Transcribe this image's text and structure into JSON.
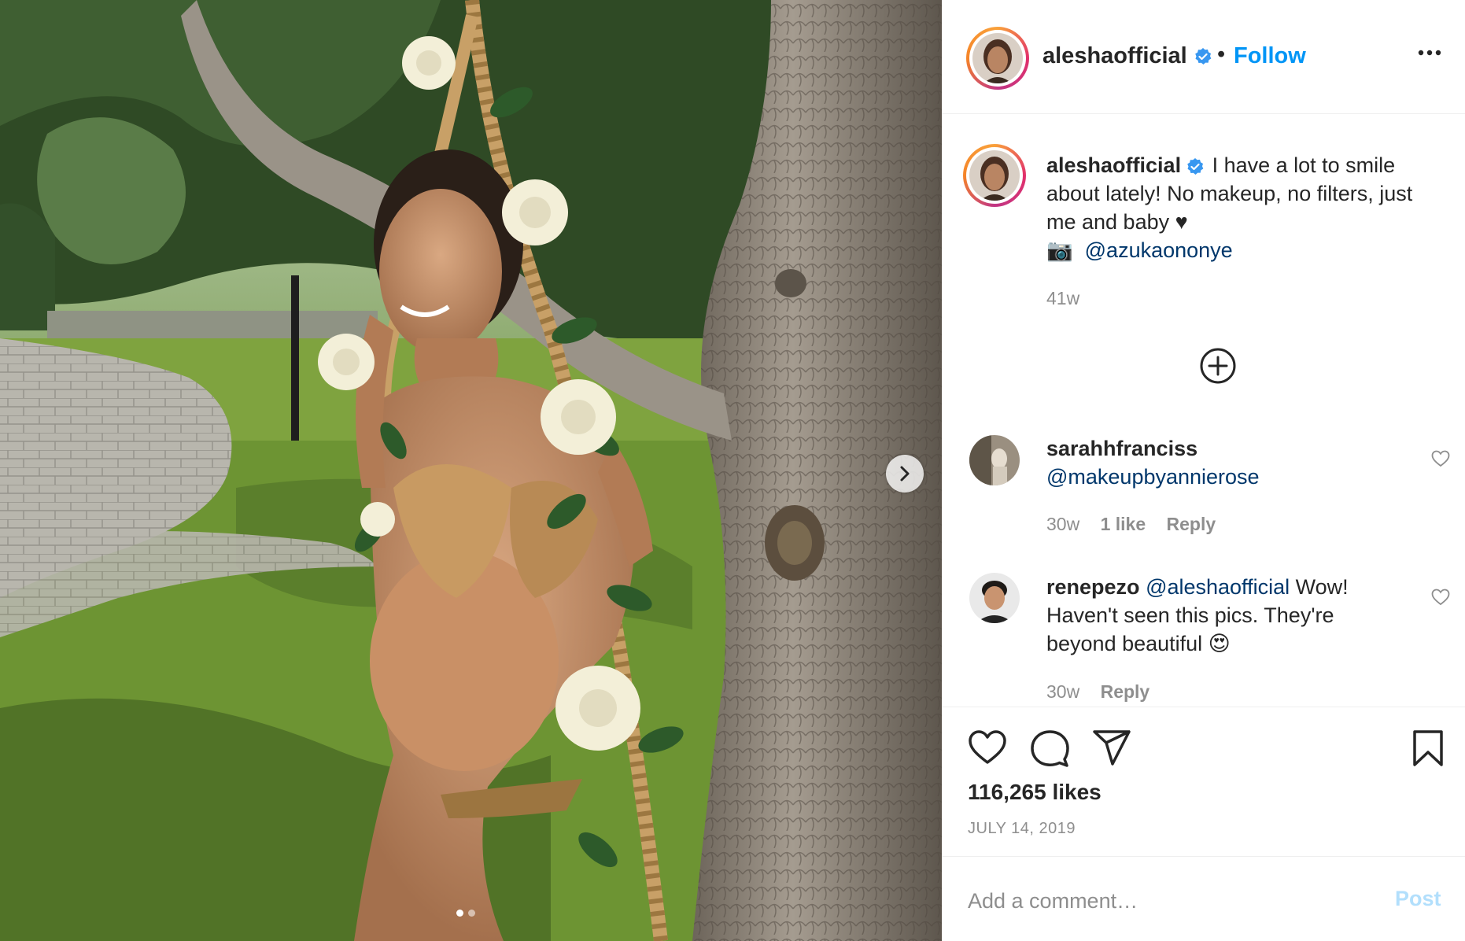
{
  "post": {
    "image_alt": "Photo of a pregnant woman on a rope swing decorated with white roses beside a tree",
    "slide_count": 2,
    "active_slide": 1
  },
  "header": {
    "username": "aleshaofficial",
    "separator": "•",
    "follow_label": "Follow",
    "more_icon": "more-options-icon"
  },
  "caption": {
    "username": "aleshaofficial",
    "text": " I have a lot to smile about lately! No makeup, no filters, just me and baby ♥",
    "camera_emoji": "📷",
    "mention": "@azukaononye",
    "time": "41w"
  },
  "comments": [
    {
      "username": "sarahhfranciss",
      "mention": "@makeupbyannierose",
      "text": "",
      "time": "30w",
      "likes": "1 like",
      "reply": "Reply"
    },
    {
      "username": "renepezo",
      "mention": "@aleshaofficial",
      "text": " Wow! Haven't seen this pics. They're beyond beautiful 😍",
      "time": "30w",
      "likes": "",
      "reply": "Reply"
    }
  ],
  "stats": {
    "likes": "116,265 likes",
    "date": "JULY 14, 2019"
  },
  "add_comment": {
    "placeholder": "Add a comment…",
    "post_label": "Post"
  },
  "colors": {
    "accent": "#0095f6",
    "muted": "#8e8e8e",
    "text": "#262626",
    "mention": "#00376b",
    "post_disabled": "#b2dffc"
  }
}
